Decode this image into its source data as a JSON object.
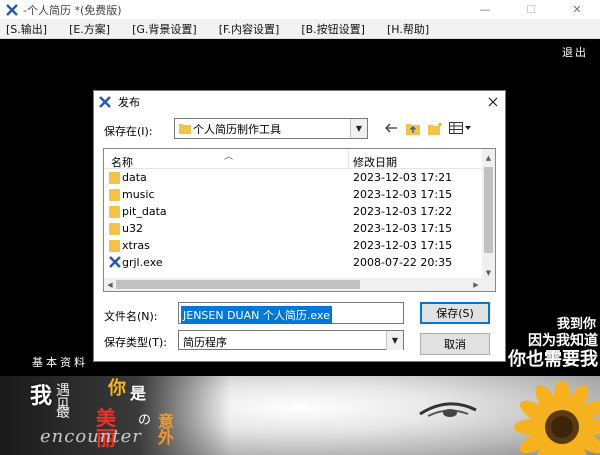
{
  "window": {
    "title": "-个人简历 *(免费版)",
    "controls": {
      "minimize": "—",
      "maximize": "☐",
      "close": "✕"
    }
  },
  "menu": [
    {
      "label": "[S.输出]"
    },
    {
      "label": "[E.方案]"
    },
    {
      "label": "[G.背景设置]"
    },
    {
      "label": "[F.内容设置]"
    },
    {
      "label": "[B.按钮设置]"
    },
    {
      "label": "[H.帮助]"
    }
  ],
  "workspace": {
    "exit_label": "退出",
    "section_label": "基本资料",
    "slogan": [
      "我到你",
      "因为我知道",
      "你也需要我"
    ],
    "banner_text": {
      "wo": "我",
      "yu_jian": "遇见",
      "ni": "你",
      "shi": "是",
      "zui": "最",
      "meili": "美丽",
      "de": "の",
      "yiwai": "意外",
      "encounter": "encounter"
    }
  },
  "dialog": {
    "title": "发布",
    "save_in_label": "保存在(I):",
    "save_in_value": "个人简历制作工具",
    "columns": {
      "name": "名称",
      "modified": "修改日期"
    },
    "files": [
      {
        "name": "data",
        "date": "2023-12-03 17:21",
        "icon": "folder-icon"
      },
      {
        "name": "music",
        "date": "2023-12-03 17:15",
        "icon": "folder-icon"
      },
      {
        "name": "pit_data",
        "date": "2023-12-03 17:22",
        "icon": "folder-icon"
      },
      {
        "name": "u32",
        "date": "2023-12-03 17:15",
        "icon": "folder-icon"
      },
      {
        "name": "xtras",
        "date": "2023-12-03 17:15",
        "icon": "folder-icon"
      },
      {
        "name": "grjl.exe",
        "date": "2008-07-22 20:35",
        "icon": "exe-icon"
      }
    ],
    "file_name_label": "文件名(N):",
    "file_name_value": "JENSEN DUAN 个人简历.exe",
    "file_type_label": "保存类型(T):",
    "file_type_value": "简历程序",
    "save_button": "保存(S)",
    "cancel_button": "取消"
  },
  "colors": {
    "accent": "#0078d7",
    "folder": "#f4c244",
    "banner_orange": "#f39a2a",
    "banner_red": "#e7342a"
  }
}
